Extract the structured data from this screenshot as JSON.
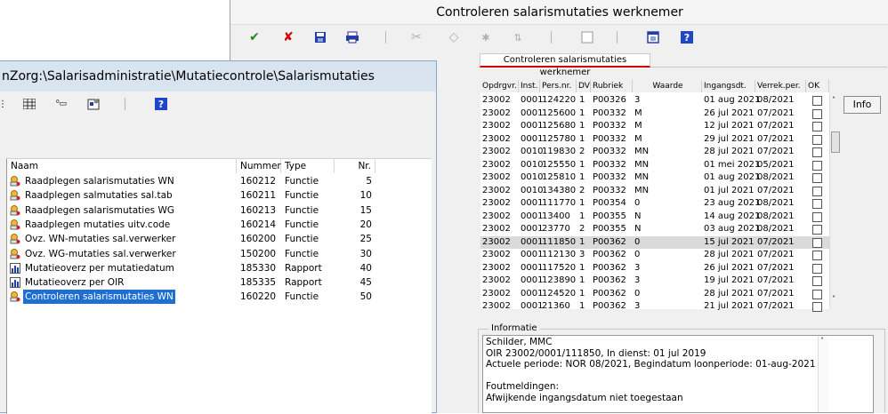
{
  "right_window": {
    "title": "Controleren salarismutaties werknemer",
    "tab_label": "Controleren salarismutaties werknemer",
    "grid_headers": [
      "Opdrgvr.",
      "Inst.",
      "Pers.nr.",
      "DV",
      "Rubriek",
      "Waarde",
      "Ingangsdt.",
      "Verrek.per.",
      "OK"
    ],
    "rows": [
      [
        "23002",
        "0001",
        "124220",
        "1",
        "P00326",
        "3",
        "01 aug 2021",
        "08/2021"
      ],
      [
        "23002",
        "0001",
        "125600",
        "1",
        "P00332",
        "M",
        "26 jul 2021",
        "07/2021"
      ],
      [
        "23002",
        "0001",
        "125680",
        "1",
        "P00332",
        "M",
        "12 jul 2021",
        "07/2021"
      ],
      [
        "23002",
        "0001",
        "125780",
        "1",
        "P00332",
        "M",
        "29 jul 2021",
        "07/2021"
      ],
      [
        "23002",
        "0010",
        "119830",
        "2",
        "P00332",
        "MN",
        "28 jul 2021",
        "07/2021"
      ],
      [
        "23002",
        "0010",
        "125550",
        "1",
        "P00332",
        "MN",
        "01 mei 2021",
        "05/2021"
      ],
      [
        "23002",
        "0010",
        "125810",
        "1",
        "P00332",
        "MN",
        "01 aug 2021",
        "08/2021"
      ],
      [
        "23002",
        "0010",
        "134380",
        "2",
        "P00332",
        "MN",
        "01 jul 2021",
        "07/2021"
      ],
      [
        "23002",
        "0001",
        "111770",
        "1",
        "P00354",
        "0",
        "23 aug 2021",
        "08/2021"
      ],
      [
        "23002",
        "0001",
        "13400",
        "1",
        "P00355",
        "N",
        "14 aug 2021",
        "08/2021"
      ],
      [
        "23002",
        "0001",
        "23770",
        "2",
        "P00355",
        "N",
        "03 aug 2021",
        "08/2021"
      ],
      [
        "23002",
        "0001",
        "111850",
        "1",
        "P00362",
        "0",
        "15 jul 2021",
        "07/2021"
      ],
      [
        "23002",
        "0001",
        "112130",
        "3",
        "P00362",
        "0",
        "28 jul 2021",
        "07/2021"
      ],
      [
        "23002",
        "0001",
        "117520",
        "1",
        "P00362",
        "3",
        "26 jul 2021",
        "07/2021"
      ],
      [
        "23002",
        "0001",
        "123890",
        "1",
        "P00362",
        "3",
        "19 jul 2021",
        "07/2021"
      ],
      [
        "23002",
        "0001",
        "124520",
        "1",
        "P00362",
        "0",
        "28 jul 2021",
        "07/2021"
      ],
      [
        "23002",
        "0001",
        "21360",
        "1",
        "P00362",
        "3",
        "21 jul 2021",
        "07/2021"
      ]
    ],
    "selected_row": 11,
    "info_button": "Info",
    "info_legend": "Informatie",
    "info_text": "Schilder, MMC\nOIR 23002/0001/111850, In dienst: 01 jul 2019\nActuele periode: NOR 08/2021, Begindatum loonperiode: 01-aug-2021\n\nFoutmeldingen:\nAfwijkende ingangsdatum niet toegestaan",
    "toolbar_icons": [
      "check-icon",
      "cancel-icon",
      "save-icon",
      "print-icon",
      "cut-icon",
      "eraser-icon",
      "star-icon",
      "sort-icon",
      "checkbox-icon",
      "window-icon",
      "help-icon"
    ]
  },
  "left_window": {
    "title": "nZorg:\\Salarisadministratie\\Mutatiecontrole\\Salarismutaties",
    "list_headers": [
      "Naam",
      "Nummer",
      "Type",
      "Nr."
    ],
    "items": [
      {
        "naam": "Raadplegen salarismutaties WN",
        "nummer": "160212",
        "type": "Functie",
        "nr": "5",
        "icon": "function-icon"
      },
      {
        "naam": "Raadplegen salmutaties sal.tab",
        "nummer": "160211",
        "type": "Functie",
        "nr": "10",
        "icon": "function-icon"
      },
      {
        "naam": "Raadplegen salarismutaties WG",
        "nummer": "160213",
        "type": "Functie",
        "nr": "15",
        "icon": "function-icon"
      },
      {
        "naam": "Raadplegen mutaties uitv.code",
        "nummer": "160214",
        "type": "Functie",
        "nr": "20",
        "icon": "function-icon"
      },
      {
        "naam": "Ovz. WN-mutaties sal.verwerker",
        "nummer": "160200",
        "type": "Functie",
        "nr": "25",
        "icon": "function-icon"
      },
      {
        "naam": "Ovz. WG-mutaties sal.verwerker",
        "nummer": "150200",
        "type": "Functie",
        "nr": "30",
        "icon": "function-icon"
      },
      {
        "naam": "Mutatieoverz per mutatiedatum",
        "nummer": "185330",
        "type": "Rapport",
        "nr": "40",
        "icon": "report-icon"
      },
      {
        "naam": "Mutatieoverz per OIR",
        "nummer": "185335",
        "type": "Rapport",
        "nr": "45",
        "icon": "report-icon"
      },
      {
        "naam": "Controleren salarismutaties WN",
        "nummer": "160220",
        "type": "Functie",
        "nr": "50",
        "icon": "function-icon"
      }
    ],
    "selected_item": 8
  },
  "colors": {
    "accent_red": "#d00000",
    "selection_blue": "#1f6fd1",
    "check_green": "#1a8a1a",
    "help_blue": "#1e46c8"
  }
}
